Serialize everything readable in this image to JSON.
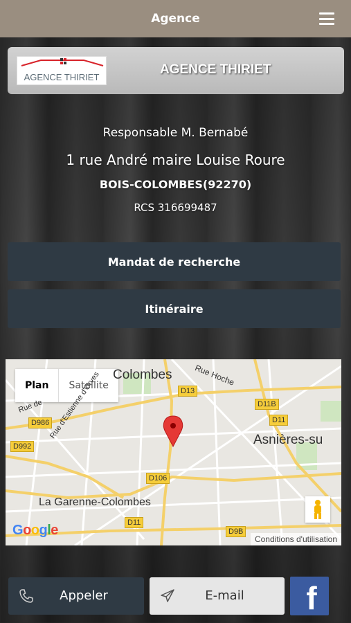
{
  "header": {
    "title": "Agence"
  },
  "agency": {
    "logo_text": "AGENCE THIRIET",
    "name": "AGENCE THIRIET",
    "responsable": "Responsable M. Bernabé",
    "address": "1 rue André maire Louise Roure",
    "city": "BOIS-COLOMBES(92270)",
    "rcs": "RCS 316699487"
  },
  "actions": {
    "mandat": "Mandat de recherche",
    "itineraire": "Itinéraire"
  },
  "map": {
    "tabs": [
      "Plan",
      "Satellite"
    ],
    "labels": {
      "colombes": "Colombes",
      "rue_hoche": "Rue Hoche",
      "asnieres": "Asnières-su",
      "garenne": "La Garenne-Colombes",
      "rue_estienne": "Rue d'Estienne d'Orves",
      "rue_de": "Rue de"
    },
    "roads": [
      "D13",
      "D986",
      "D992",
      "D11B",
      "D11",
      "D106",
      "D11",
      "D9B"
    ],
    "google": "Google",
    "terms": "Conditions d'utilisation"
  },
  "bottom": {
    "call": "Appeler",
    "email": "E-mail",
    "facebook": "f"
  },
  "colors": {
    "topbar": "#9a8e80",
    "button": "#2f3a44",
    "facebook": "#3b5ba0",
    "marker": "#e53935"
  }
}
